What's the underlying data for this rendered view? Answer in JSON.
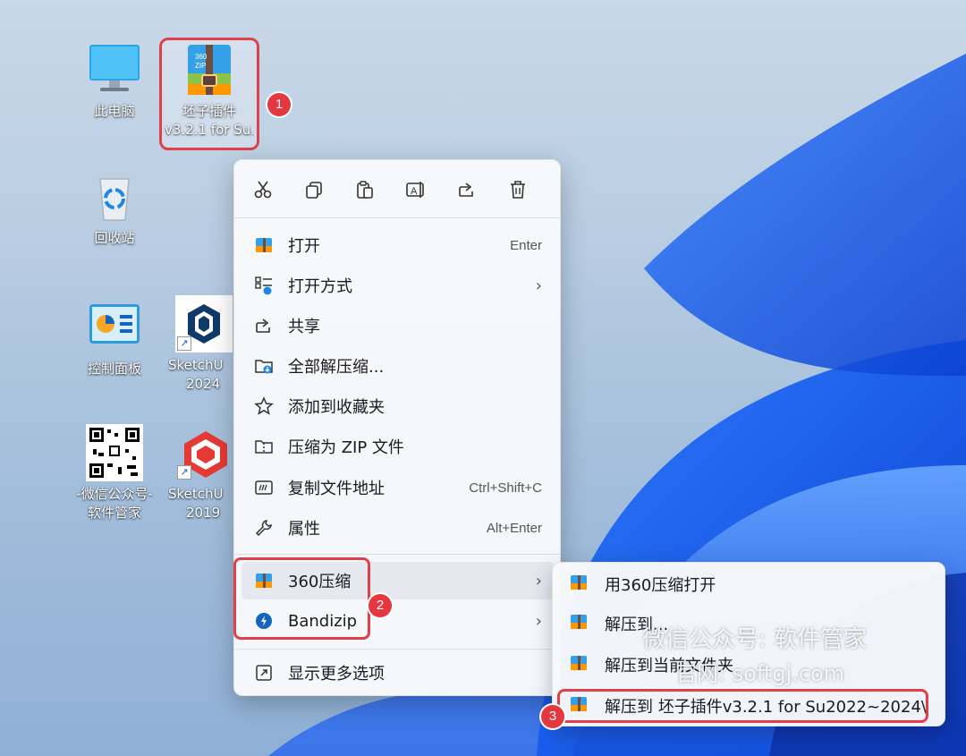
{
  "desktop": {
    "icons": [
      {
        "label": "此电脑"
      },
      {
        "label_line1": "坯子插件",
        "label_line2": "v3.2.1 for Su..."
      },
      {
        "label": "回收站"
      },
      {
        "label": "控制面板"
      },
      {
        "label_line1": "SketchU",
        "label_line2": "2024"
      },
      {
        "label_line1": "-微信公众号-",
        "label_line2": "软件管家"
      },
      {
        "label_line1": "SketchU",
        "label_line2": "2019"
      }
    ]
  },
  "badges": [
    "1",
    "2",
    "3"
  ],
  "context_menu": {
    "toolbar": [
      {
        "icon": "cut-icon"
      },
      {
        "icon": "copy-icon"
      },
      {
        "icon": "paste-icon"
      },
      {
        "icon": "rename-icon"
      },
      {
        "icon": "share-icon"
      },
      {
        "icon": "delete-icon"
      }
    ],
    "items": [
      {
        "label": "打开",
        "shortcut": "Enter"
      },
      {
        "label": "打开方式",
        "chevron": "›"
      },
      {
        "label": "共享"
      },
      {
        "label": "全部解压缩..."
      },
      {
        "label": "添加到收藏夹"
      },
      {
        "label": "压缩为 ZIP 文件"
      },
      {
        "label": "复制文件地址",
        "shortcut": "Ctrl+Shift+C"
      },
      {
        "label": "属性",
        "shortcut": "Alt+Enter"
      },
      {
        "label": "360压缩",
        "chevron": "›"
      },
      {
        "label": "Bandizip",
        "chevron": "›"
      },
      {
        "label": "显示更多选项"
      }
    ]
  },
  "submenu": {
    "items": [
      {
        "label": "用360压缩打开"
      },
      {
        "label": "解压到..."
      },
      {
        "label": "解压到当前文件夹"
      },
      {
        "label": "解压到 坯子插件v3.2.1 for Su2022~2024\\"
      }
    ]
  },
  "watermark": {
    "line1": "微信公众号: 软件管家",
    "line2": "官网: softgj.com"
  },
  "colors": {
    "highlight_box": "#e0404a",
    "badge": "#e5373f",
    "menu_bg": "#f8f9fb"
  }
}
